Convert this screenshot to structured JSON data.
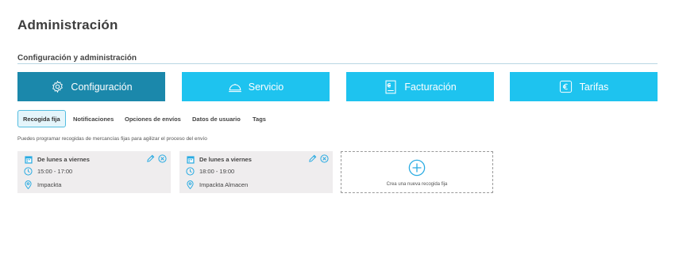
{
  "page": {
    "title": "Administración"
  },
  "section": {
    "title": "Configuración y administración"
  },
  "main_tabs": [
    {
      "label": "Configuración",
      "icon": "gear-icon",
      "active": true
    },
    {
      "label": "Servicio",
      "icon": "cloche-icon",
      "active": false
    },
    {
      "label": "Facturación",
      "icon": "invoice-icon",
      "active": false
    },
    {
      "label": "Tarifas",
      "icon": "euro-icon",
      "active": false
    }
  ],
  "sub_tabs": [
    {
      "label": "Recogida fija",
      "active": true
    },
    {
      "label": "Notificaciones",
      "active": false
    },
    {
      "label": "Opciones de envíos",
      "active": false
    },
    {
      "label": "Datos de usuario",
      "active": false
    },
    {
      "label": "Tags",
      "active": false
    }
  ],
  "help_text": "Puedes programar recogidas de mercancías fijas para agilizar el proceso del envío",
  "pickups": [
    {
      "days": "De lunes a viernes",
      "hours": "15:00 - 17:00",
      "location": "Impackta"
    },
    {
      "days": "De lunes a viernes",
      "hours": "18:00 - 19:00",
      "location": "Impackta Almacen"
    }
  ],
  "add_pickup": {
    "label": "Crea una nueva recogida fija"
  },
  "colors": {
    "tab_active": "#1b88ab",
    "tab_inactive": "#1ec3ef",
    "accent_icon": "#29abe2",
    "card_bg": "#efedee"
  }
}
